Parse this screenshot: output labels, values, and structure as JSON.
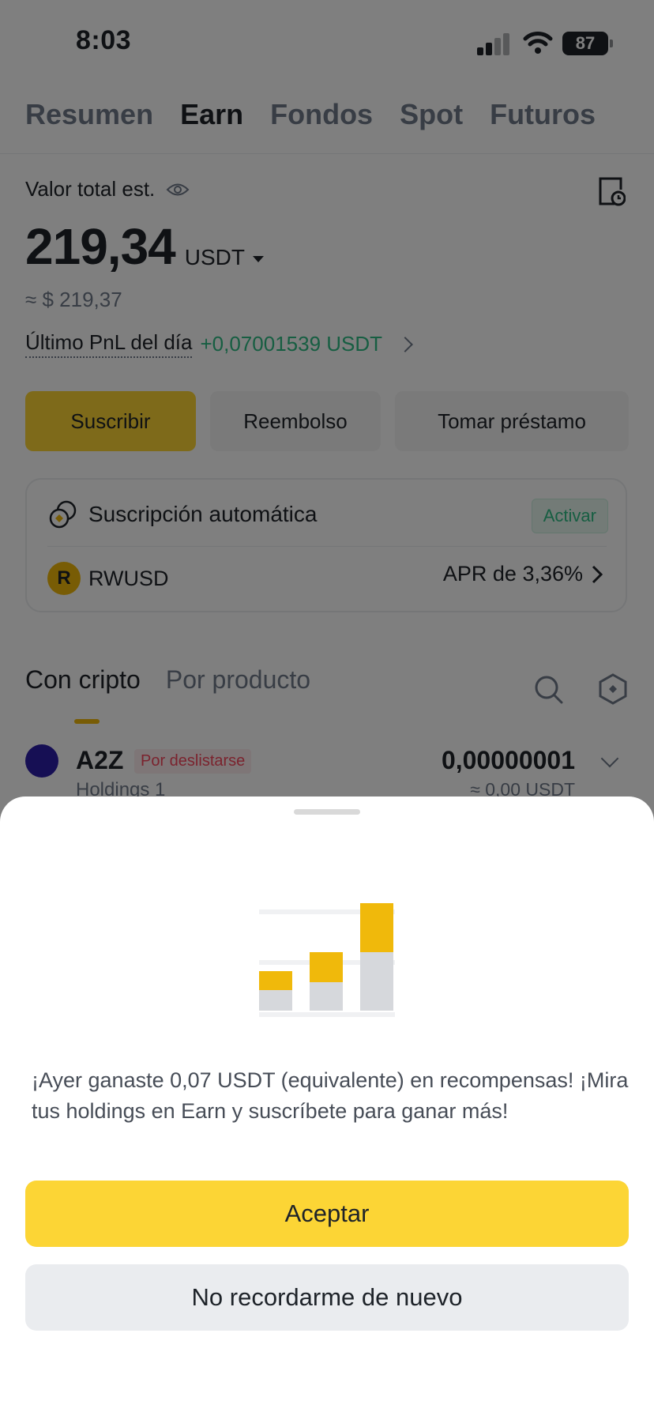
{
  "status_bar": {
    "time": "8:03",
    "battery": "87"
  },
  "tabs": [
    {
      "label": "Resumen"
    },
    {
      "label": "Earn"
    },
    {
      "label": "Fondos"
    },
    {
      "label": "Spot"
    },
    {
      "label": "Futuros"
    }
  ],
  "balance": {
    "label": "Valor total est.",
    "amount": "219,34",
    "unit": "USDT",
    "approx": "≈ $ 219,37",
    "pnl_label": "Último PnL del día",
    "pnl_value": "+0,07001539 USDT"
  },
  "actions": {
    "subscribe": "Suscribir",
    "redeem": "Reembolso",
    "loan": "Tomar préstamo"
  },
  "auto_sub": {
    "title": "Suscripción automática",
    "activate": "Activar",
    "asset": "RWUSD",
    "asset_logo": "R",
    "apr": "APR de 3,36%"
  },
  "list_tabs": {
    "crypto": "Con cripto",
    "product": "Por producto"
  },
  "holdings": [
    {
      "name": "A2Z",
      "tag": "Por deslistarse",
      "sub": "Holdings 1",
      "amount": "0,00000001",
      "usdt": "≈ 0,00 USDT"
    }
  ],
  "sheet": {
    "message": "¡Ayer ganaste 0,07 USDT (equivalente) en recompensas! ¡Mira tus holdings en Earn y suscríbete para ganar más!",
    "accept": "Aceptar",
    "dismiss": "No recordarme de nuevo"
  },
  "colors": {
    "brand_yellow": "#fcd535",
    "positive": "#2ebd85",
    "negative": "#f6465d"
  }
}
